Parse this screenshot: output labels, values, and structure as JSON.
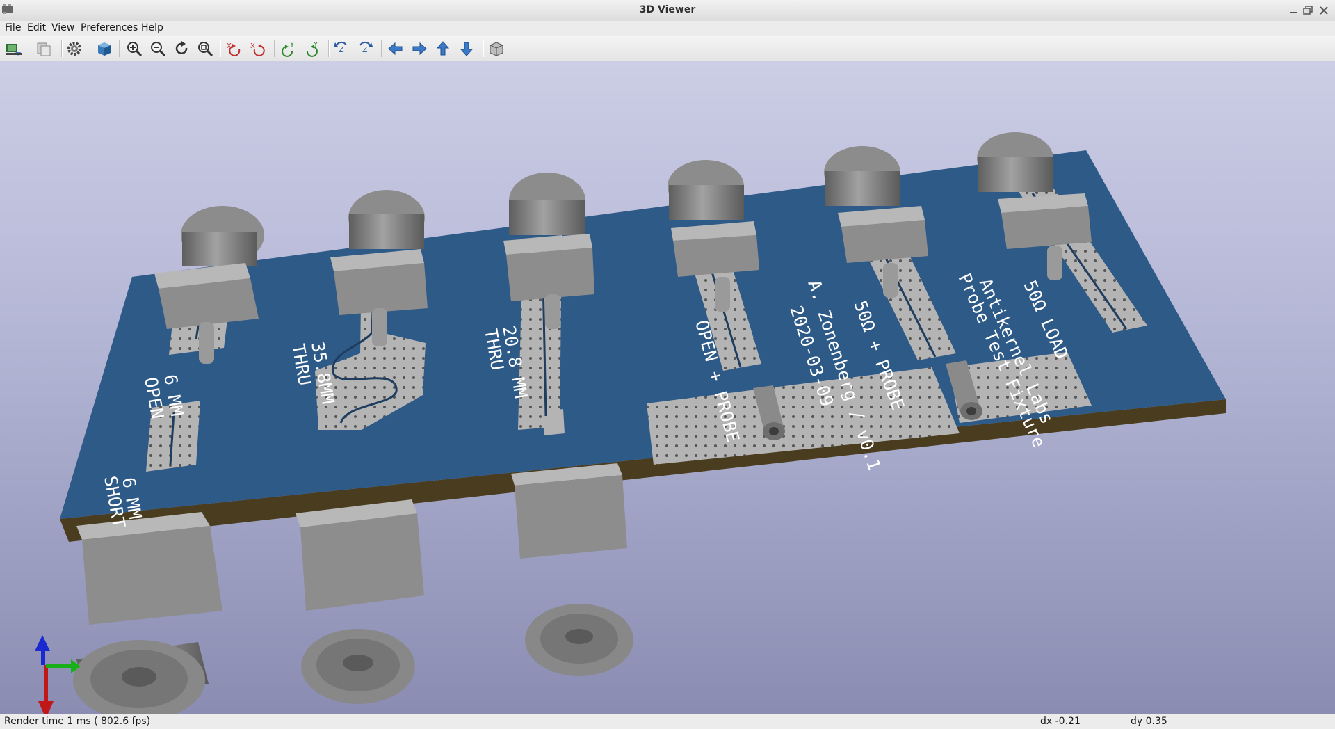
{
  "window": {
    "title": "3D Viewer"
  },
  "menubar": {
    "items": [
      {
        "label": "File"
      },
      {
        "label": "Edit"
      },
      {
        "label": "View"
      },
      {
        "label": "Preferences"
      },
      {
        "label": "Help"
      }
    ]
  },
  "toolbar": {
    "buttons": [
      {
        "icon": "export-image-icon"
      },
      {
        "icon": "copy-clipboard-icon"
      },
      {
        "icon": "settings-gear-icon"
      },
      {
        "icon": "raytracing-cube-icon"
      },
      {
        "icon": "zoom-in-icon"
      },
      {
        "icon": "zoom-out-icon"
      },
      {
        "icon": "redraw-icon"
      },
      {
        "icon": "zoom-fit-icon"
      },
      {
        "icon": "rotate-x-cw-icon"
      },
      {
        "icon": "rotate-x-ccw-icon"
      },
      {
        "icon": "rotate-y-cw-icon"
      },
      {
        "icon": "rotate-y-ccw-icon"
      },
      {
        "icon": "rotate-z-cw-icon"
      },
      {
        "icon": "rotate-z-ccw-icon"
      },
      {
        "icon": "move-left-icon"
      },
      {
        "icon": "move-right-icon"
      },
      {
        "icon": "move-up-icon"
      },
      {
        "icon": "move-down-icon"
      },
      {
        "icon": "ortho-projection-icon"
      }
    ]
  },
  "scene": {
    "board_labels": [
      {
        "text": "6 MM"
      },
      {
        "text": "OPEN"
      },
      {
        "text": "35.8MM"
      },
      {
        "text": "THRU"
      },
      {
        "text": "20.8 MM"
      },
      {
        "text": "THRU"
      },
      {
        "text": "OPEN + PROBE"
      },
      {
        "text": "A. Zonenberg / v0.1"
      },
      {
        "text": "2020-03-09"
      },
      {
        "text": "50Ω + PROBE"
      },
      {
        "text": "Antikernel Labs"
      },
      {
        "text": "Probe Test Fixture"
      },
      {
        "text": "50Ω LOAD"
      },
      {
        "text": "6 MM"
      },
      {
        "text": "SHORT"
      }
    ],
    "colors": {
      "board": "#2e5a88",
      "board_edge": "#4a3c1e",
      "copper_pad": "#b4b4b4",
      "connector": "#8c8c8c",
      "silkscreen": "#ffffff"
    }
  },
  "statusbar": {
    "render_time": "Render time 1 ms ( 802.6 fps)",
    "dx": "dx -0.21",
    "dy": "dy 0.35"
  }
}
